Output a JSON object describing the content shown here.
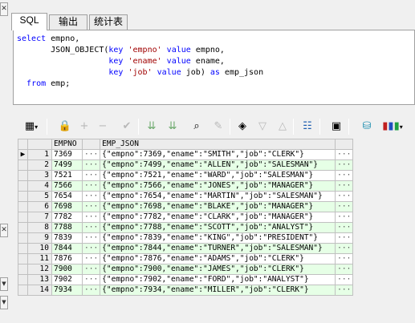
{
  "tabs": [
    "SQL",
    "输出",
    "统计表"
  ],
  "sql_lines": [
    [
      "select empno,"
    ],
    [
      "       JSON_OBJECT(key 'empno' value empno,"
    ],
    [
      "                   key 'ename' value ename,"
    ],
    [
      "                   key 'job' value job) as emp_json"
    ],
    [
      "  from emp;"
    ]
  ],
  "grid": {
    "columns": [
      "EMPNO",
      "EMP_JSON"
    ],
    "rows": [
      {
        "n": "1",
        "empno": "7369",
        "json": "{\"empno\":7369,\"ename\":\"SMITH\",\"job\":\"CLERK\"}"
      },
      {
        "n": "2",
        "empno": "7499",
        "json": "{\"empno\":7499,\"ename\":\"ALLEN\",\"job\":\"SALESMAN\"}"
      },
      {
        "n": "3",
        "empno": "7521",
        "json": "{\"empno\":7521,\"ename\":\"WARD\",\"job\":\"SALESMAN\"}"
      },
      {
        "n": "4",
        "empno": "7566",
        "json": "{\"empno\":7566,\"ename\":\"JONES\",\"job\":\"MANAGER\"}"
      },
      {
        "n": "5",
        "empno": "7654",
        "json": "{\"empno\":7654,\"ename\":\"MARTIN\",\"job\":\"SALESMAN\"}"
      },
      {
        "n": "6",
        "empno": "7698",
        "json": "{\"empno\":7698,\"ename\":\"BLAKE\",\"job\":\"MANAGER\"}"
      },
      {
        "n": "7",
        "empno": "7782",
        "json": "{\"empno\":7782,\"ename\":\"CLARK\",\"job\":\"MANAGER\"}"
      },
      {
        "n": "8",
        "empno": "7788",
        "json": "{\"empno\":7788,\"ename\":\"SCOTT\",\"job\":\"ANALYST\"}"
      },
      {
        "n": "9",
        "empno": "7839",
        "json": "{\"empno\":7839,\"ename\":\"KING\",\"job\":\"PRESIDENT\"}"
      },
      {
        "n": "10",
        "empno": "7844",
        "json": "{\"empno\":7844,\"ename\":\"TURNER\",\"job\":\"SALESMAN\"}"
      },
      {
        "n": "11",
        "empno": "7876",
        "json": "{\"empno\":7876,\"ename\":\"ADAMS\",\"job\":\"CLERK\"}"
      },
      {
        "n": "12",
        "empno": "7900",
        "json": "{\"empno\":7900,\"ename\":\"JAMES\",\"job\":\"CLERK\"}"
      },
      {
        "n": "13",
        "empno": "7902",
        "json": "{\"empno\":7902,\"ename\":\"FORD\",\"job\":\"ANALYST\"}"
      },
      {
        "n": "14",
        "empno": "7934",
        "json": "{\"empno\":7934,\"ename\":\"MILLER\",\"job\":\"CLERK\"}"
      }
    ]
  },
  "icons": {
    "left": [
      "close-icon",
      "close-icon",
      "dropdown-arrow-icon",
      "dropdown-arrow-icon"
    ],
    "toolbar": [
      "grid-icon",
      "lock-icon",
      "add-record-icon",
      "delete-record-icon",
      "post-changes-icon",
      "next-record-icon",
      "last-record-icon",
      "find-icon",
      "clear-icon",
      "query-by-example-icon",
      "filter-down-icon",
      "filter-up-icon",
      "explain-plan-icon",
      "save-icon",
      "export-icon",
      "chart-icon"
    ]
  },
  "colors": {
    "keyword": "#0000ff",
    "string": "#a00000",
    "alt_row": "#e6ffe6"
  }
}
